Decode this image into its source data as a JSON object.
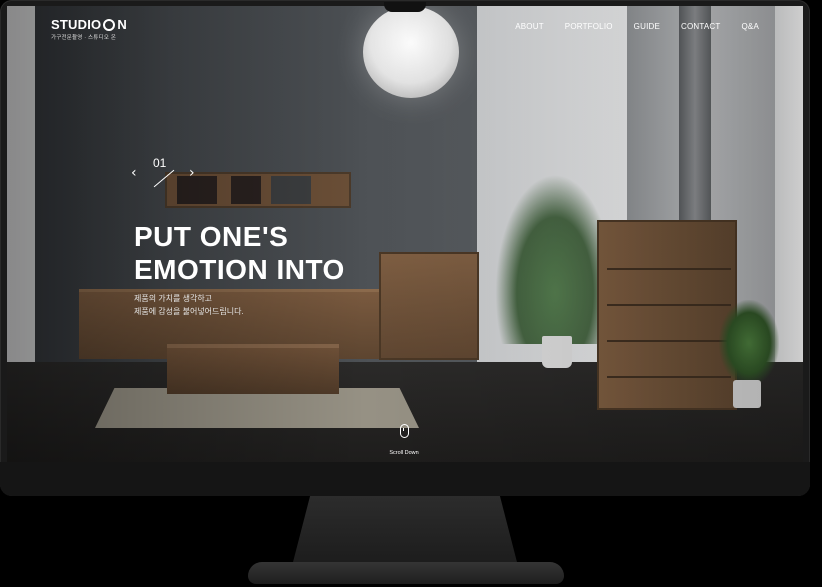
{
  "site": {
    "logo_main_prefix": "STUDIO",
    "logo_main_suffix": "N",
    "logo_sub": "가구전문촬영 · 스튜디오 온"
  },
  "nav": {
    "items": [
      {
        "label": "ABOUT"
      },
      {
        "label": "PORTFOLIO"
      },
      {
        "label": "GUIDE"
      },
      {
        "label": "CONTACT"
      },
      {
        "label": "Q&A"
      }
    ]
  },
  "hero": {
    "slide_number": "01",
    "prev_arrow": "‹",
    "next_arrow": "›",
    "headline_line1": "PUT ONE'S",
    "headline_line2": "EMOTION INTO",
    "sub_line1": "제품의 가치를 생각하고",
    "sub_line2": "제품에 감성을 불어넣어드립니다."
  },
  "scroll": {
    "label": "Scroll Down"
  },
  "monitor": {
    "apple_logo": ""
  }
}
